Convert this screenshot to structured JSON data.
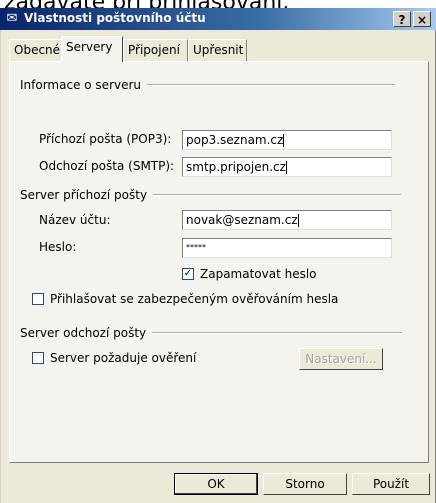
{
  "top_caption": "zadávate při přihlašování.",
  "window": {
    "title": "Vlastnosti poštovního účtu",
    "help_button": "?",
    "close_button": "×"
  },
  "tabs": [
    {
      "label": "Obecné",
      "active": false
    },
    {
      "label": "Servery",
      "active": true
    },
    {
      "label": "Připojení",
      "active": false
    },
    {
      "label": "Upřesnit",
      "active": false
    }
  ],
  "server_info": {
    "group_label": "Informace o serveru",
    "incoming_label": "Příchozí pošta (POP3):",
    "incoming_value": "pop3.seznam.cz",
    "outgoing_label": "Odchozí pošta (SMTP):",
    "outgoing_value": "smtp.pripojen.cz"
  },
  "incoming_server": {
    "group_label": "Server příchozí pošty",
    "account_label": "Název účtu:",
    "account_value": "novak@seznam.cz",
    "password_label": "Heslo:",
    "password_value": "*****",
    "remember_label": "Zapamatovat heslo",
    "remember_checked": true,
    "spa_label": "Přihlašovat se zabezpečeným ověřováním hesla",
    "spa_checked": false
  },
  "outgoing_server": {
    "group_label": "Server odchozí pošty",
    "auth_label": "Server požaduje ověření",
    "auth_checked": false,
    "settings_button": "Nastavení..."
  },
  "footer": {
    "ok": "OK",
    "cancel": "Storno",
    "apply": "Použít"
  }
}
